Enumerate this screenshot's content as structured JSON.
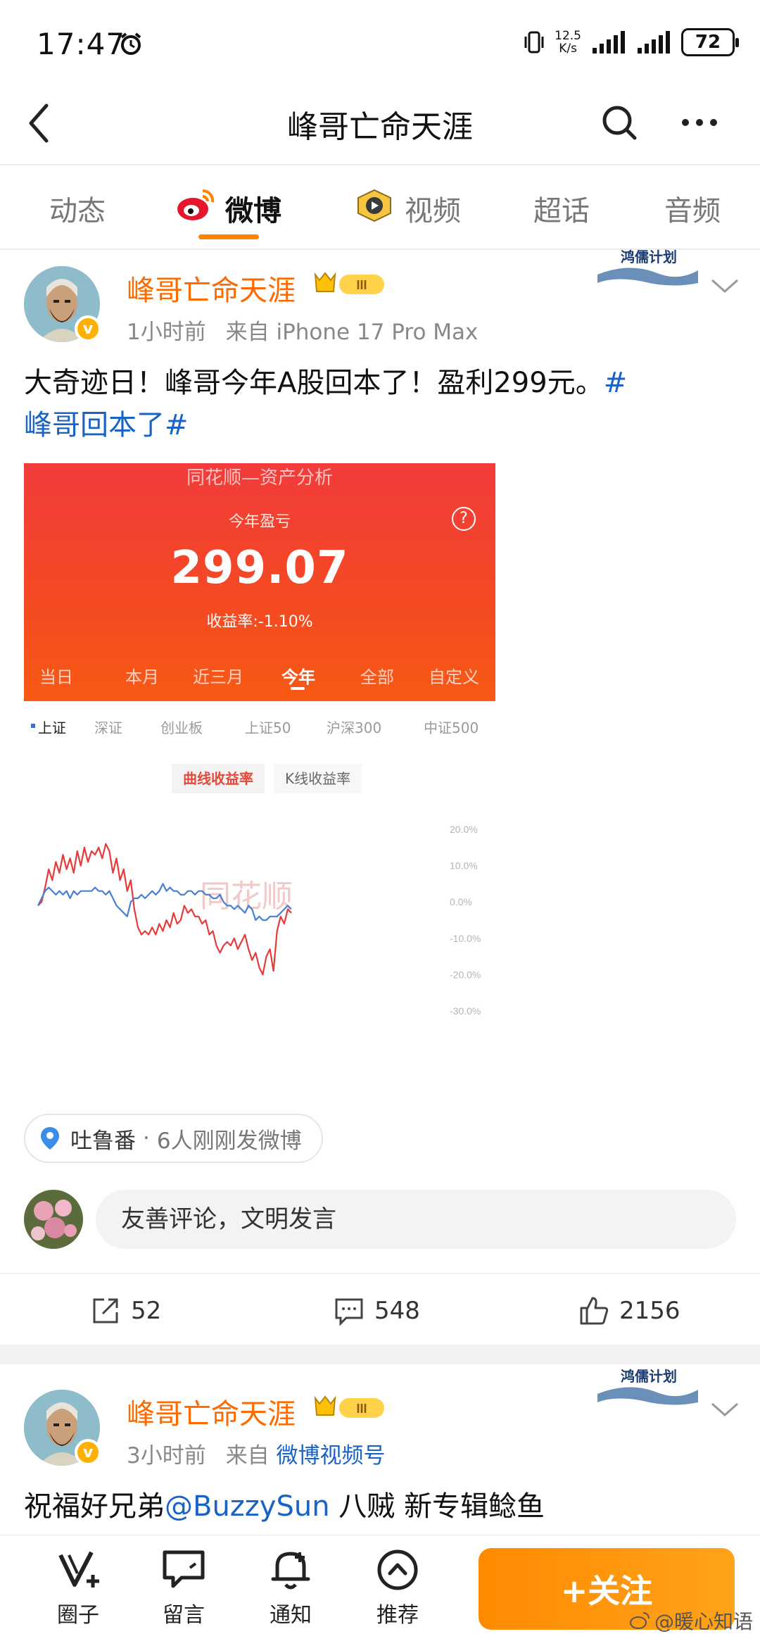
{
  "status_bar": {
    "time": "17:47",
    "net_speed_value": "12.5",
    "net_speed_unit": "K/s",
    "battery": "72"
  },
  "nav": {
    "title": "峰哥亡命天涯"
  },
  "tabs": [
    {
      "label": "动态"
    },
    {
      "label": "微博"
    },
    {
      "label": "视频"
    },
    {
      "label": "超话"
    },
    {
      "label": "音频"
    }
  ],
  "post1": {
    "author": "峰哥亡命天涯",
    "level": "III",
    "time": "1小时前",
    "source_prefix": "来自",
    "source": "iPhone 17 Pro Max",
    "badge_text": "鸿儒计划",
    "text_main": "大奇迹日！峰哥今年A股回本了！盈利299元。",
    "topic_line1": "#",
    "topic_line2": "峰哥回本了#",
    "location": "吐鲁番",
    "location_sep": "·",
    "location_extra": "6人刚刚发微博",
    "comment_placeholder": "友善评论，文明发言",
    "shares": "52",
    "comments": "548",
    "likes": "2156"
  },
  "screenshot": {
    "header": "同花顺—资产分析",
    "subtitle": "今年盈亏",
    "amount": "299.07",
    "rate": "收益率:-1.10%",
    "help": "?",
    "ranges": [
      "当日",
      "本月",
      "近三月",
      "今年",
      "全部",
      "自定义"
    ],
    "indices": [
      "上证",
      "深证",
      "创业板",
      "上证50",
      "沪深300",
      "中证500"
    ],
    "curve_tab_on": "曲线收益率",
    "curve_tab_off": "K线收益率",
    "y_labels": [
      "20.0%",
      "10.0%",
      "0.0%",
      "-10.0%",
      "-20.0%",
      "-30.0%"
    ],
    "watermark": "同花顺",
    "colors": {
      "account": "#e63b3b",
      "index": "#4a7fd0"
    }
  },
  "chart_data": {
    "type": "line",
    "title": "",
    "xlabel": "",
    "ylabel": "",
    "ylim": [
      -30,
      20
    ],
    "grid": false,
    "series": [
      {
        "values": [
          -1,
          0,
          4,
          9,
          6,
          11,
          8,
          13,
          9,
          12,
          8,
          14,
          10,
          15,
          11,
          14,
          13,
          15,
          12,
          16,
          14,
          8,
          12,
          6,
          9,
          3,
          6,
          -2,
          -7,
          -9,
          -8,
          -9,
          -7,
          -9,
          -6,
          -8,
          -5,
          -7,
          -3,
          -6,
          -5,
          -1,
          -3,
          -2,
          -4,
          -4,
          -6,
          -5,
          -9,
          -8,
          -12,
          -14,
          -12,
          -11,
          -12,
          -10,
          -13,
          -11,
          -9,
          -13,
          -16,
          -14,
          -18,
          -20,
          -15,
          -13,
          -19,
          -8,
          -4,
          -6,
          -2,
          -3
        ]
      },
      {
        "values": [
          -1,
          1,
          3,
          4,
          3,
          2,
          3,
          2,
          3,
          1,
          3,
          2,
          3,
          3,
          3,
          3,
          4,
          3,
          3,
          2,
          3,
          1,
          -1,
          -2,
          -3,
          -4,
          0,
          1,
          1,
          2,
          1,
          2,
          3,
          2,
          3,
          5,
          3,
          4,
          3,
          3,
          2,
          2,
          3,
          3,
          2,
          3,
          3,
          2,
          2,
          1,
          1,
          2,
          0,
          -1,
          -1,
          -2,
          -1,
          -2,
          -3,
          -1,
          -2,
          -5,
          -4,
          -5,
          -5,
          -4,
          -4,
          -4,
          -3,
          -2,
          -1,
          -2
        ]
      }
    ]
  },
  "post2": {
    "author": "峰哥亡命天涯",
    "level": "III",
    "time": "3小时前",
    "source_prefix": "来自",
    "source": "微博视频号",
    "badge_text": "鸿儒计划",
    "text_prefix": "祝福好兄弟",
    "mention": "@BuzzySun",
    "text_suffix": " 八贼 新专辑鲶鱼"
  },
  "bottom_bar": {
    "items": [
      "圈子",
      "留言",
      "通知",
      "推荐"
    ],
    "follow": "+关注",
    "watermark": "@暖心知语"
  }
}
